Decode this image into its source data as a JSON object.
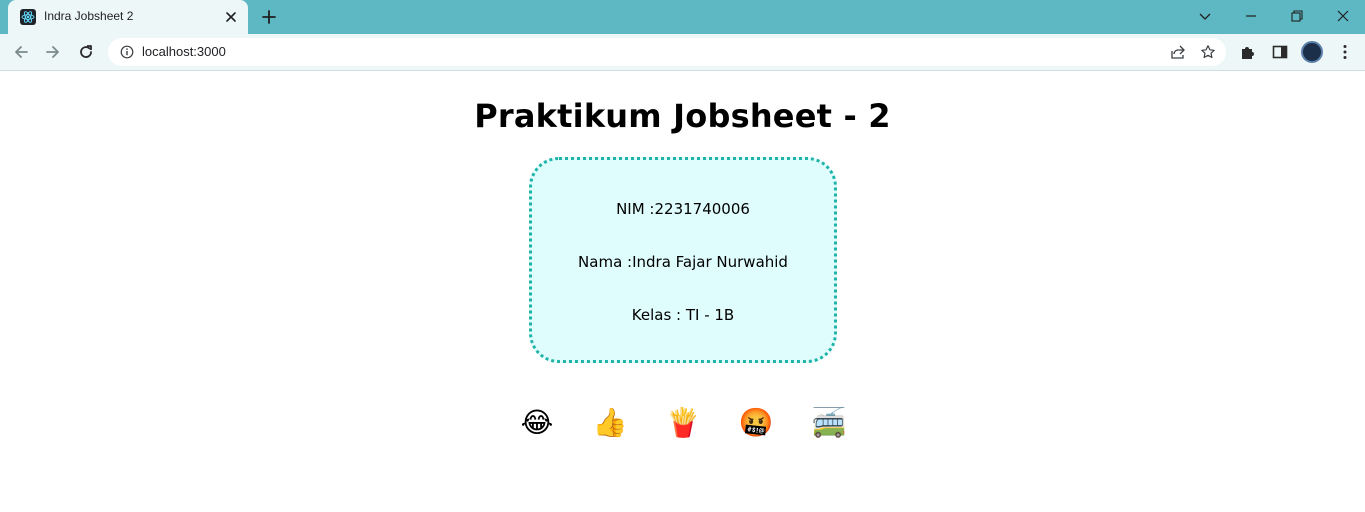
{
  "browser": {
    "tab_title": "Indra Jobsheet 2",
    "url": "localhost:3000",
    "icons": {
      "favicon": "react-icon",
      "close": "close-icon",
      "new_tab": "plus-icon",
      "back": "arrow-left-icon",
      "forward": "arrow-right-icon",
      "reload": "reload-icon",
      "info": "info-icon",
      "share": "share-icon",
      "bookmark": "star-icon",
      "extensions": "puzzle-icon",
      "sidepanel": "side-panel-icon",
      "menu": "kebab-menu-icon"
    },
    "colors": {
      "tabbar": "#5db8c3",
      "toolbar": "#eef7f8"
    }
  },
  "page": {
    "title": "Praktikum Jobsheet - 2",
    "card": {
      "nim": "NIM :2231740006",
      "nama": "Nama :Indra Fajar Nurwahid",
      "kelas": "Kelas : TI - 1B",
      "colors": {
        "background": "#e0fdfd",
        "border": "#1fb3a8"
      }
    },
    "emojis": [
      "😂",
      "👍",
      "🍟",
      "🤬",
      "🚎"
    ]
  }
}
